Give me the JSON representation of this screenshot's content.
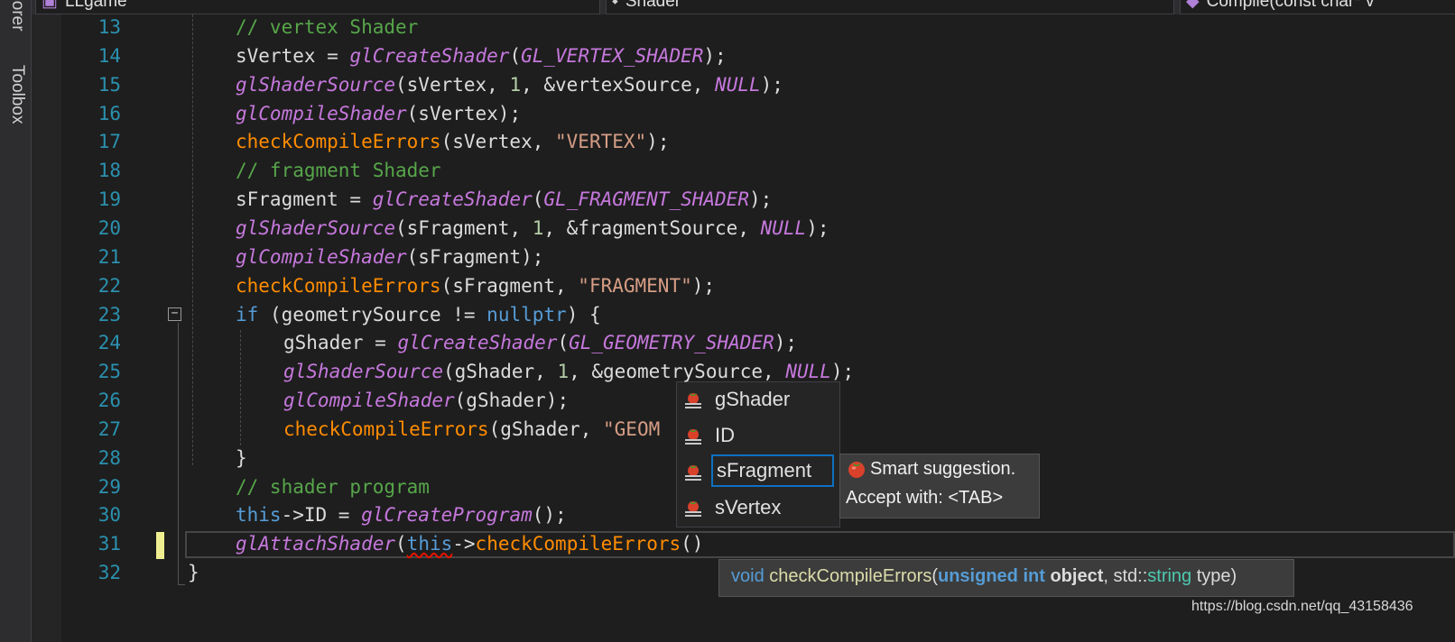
{
  "side_tabs": {
    "explorer": "plorer",
    "toolbox": "Toolbox"
  },
  "navbar": {
    "project": "LLgame",
    "class": "Shader",
    "member": "Compile(const char* v"
  },
  "lines": [
    {
      "n": "13",
      "tokens": [
        [
          "cm",
          "// vertex Shader"
        ]
      ]
    },
    {
      "n": "14",
      "tokens": [
        [
          "",
          "sVertex = "
        ],
        [
          "fn",
          "glCreateShader"
        ],
        [
          "",
          "("
        ],
        [
          "mac",
          "GL_VERTEX_SHADER"
        ],
        [
          "",
          ");"
        ]
      ]
    },
    {
      "n": "15",
      "tokens": [
        [
          "fn",
          "glShaderSource"
        ],
        [
          "",
          "(sVertex, "
        ],
        [
          "lit",
          "1"
        ],
        [
          "",
          ", &vertexSource, "
        ],
        [
          "mac",
          "NULL"
        ],
        [
          "",
          ");"
        ]
      ]
    },
    {
      "n": "16",
      "tokens": [
        [
          "fn",
          "glCompileShader"
        ],
        [
          "",
          "(sVertex);"
        ]
      ]
    },
    {
      "n": "17",
      "tokens": [
        [
          "ufn",
          "checkCompileErrors"
        ],
        [
          "",
          "(sVertex, "
        ],
        [
          "str",
          "\"VERTEX\""
        ],
        [
          "",
          ");"
        ]
      ]
    },
    {
      "n": "18",
      "tokens": [
        [
          "cm",
          "// fragment Shader"
        ]
      ]
    },
    {
      "n": "19",
      "tokens": [
        [
          "",
          "sFragment = "
        ],
        [
          "fn",
          "glCreateShader"
        ],
        [
          "",
          "("
        ],
        [
          "mac",
          "GL_FRAGMENT_SHADER"
        ],
        [
          "",
          ");"
        ]
      ]
    },
    {
      "n": "20",
      "tokens": [
        [
          "fn",
          "glShaderSource"
        ],
        [
          "",
          "(sFragment, "
        ],
        [
          "lit",
          "1"
        ],
        [
          "",
          ", &fragmentSource, "
        ],
        [
          "mac",
          "NULL"
        ],
        [
          "",
          ");"
        ]
      ]
    },
    {
      "n": "21",
      "tokens": [
        [
          "fn",
          "glCompileShader"
        ],
        [
          "",
          "(sFragment);"
        ]
      ]
    },
    {
      "n": "22",
      "tokens": [
        [
          "ufn",
          "checkCompileErrors"
        ],
        [
          "",
          "(sFragment, "
        ],
        [
          "str",
          "\"FRAGMENT\""
        ],
        [
          "",
          ");"
        ]
      ]
    },
    {
      "n": "23",
      "tokens": [
        [
          "kw",
          "if"
        ],
        [
          "",
          " (geometrySource != "
        ],
        [
          "kw",
          "nullptr"
        ],
        [
          "",
          ") {"
        ]
      ]
    },
    {
      "n": "24",
      "tokens": [
        [
          "",
          "gShader = "
        ],
        [
          "fn",
          "glCreateShader"
        ],
        [
          "",
          "("
        ],
        [
          "mac",
          "GL_GEOMETRY_SHADER"
        ],
        [
          "",
          ");"
        ]
      ]
    },
    {
      "n": "25",
      "tokens": [
        [
          "fn",
          "glShaderSource"
        ],
        [
          "",
          "(gShader, "
        ],
        [
          "lit",
          "1"
        ],
        [
          "",
          ", &geometrySource, "
        ],
        [
          "mac",
          "NULL"
        ],
        [
          "",
          ");"
        ]
      ]
    },
    {
      "n": "26",
      "tokens": [
        [
          "fn",
          "glCompileShader"
        ],
        [
          "",
          "(gShader);"
        ]
      ]
    },
    {
      "n": "27",
      "tokens": [
        [
          "ufn",
          "checkCompileErrors"
        ],
        [
          "",
          "(gShader, "
        ],
        [
          "str",
          "\"GEOM"
        ]
      ]
    },
    {
      "n": "28",
      "tokens": [
        [
          "",
          "}"
        ]
      ]
    },
    {
      "n": "29",
      "tokens": [
        [
          "cm",
          "// shader program"
        ]
      ]
    },
    {
      "n": "30",
      "tokens": [
        [
          "kw",
          "this"
        ],
        [
          "",
          "->ID = "
        ],
        [
          "fn",
          "glCreateProgram"
        ],
        [
          "",
          "();"
        ]
      ]
    },
    {
      "n": "31",
      "tokens": [
        [
          "fn",
          "glAttachShader"
        ],
        [
          "",
          "("
        ],
        [
          "kw squig",
          "this"
        ],
        [
          "",
          "->"
        ],
        [
          "ufn",
          "checkCompileErrors"
        ],
        [
          "",
          "()"
        ]
      ]
    },
    {
      "n": "32",
      "tokens": [
        [
          "",
          "}"
        ]
      ]
    }
  ],
  "completion": {
    "items": [
      "gShader",
      "ID",
      "sFragment",
      "sVertex"
    ],
    "selected_index": 2
  },
  "suggestion_tip": {
    "line1": "Smart suggestion.",
    "line2": "Accept with: <TAB>"
  },
  "param_info": {
    "ret": "void",
    "name": "checkCompileErrors",
    "open": "(",
    "p1_type": "unsigned int",
    "p1_name": "object",
    "sep": ", std::",
    "p2_type": "string",
    "p2_name": " type",
    "close": ")"
  },
  "watermark": "https://blog.csdn.net/qq_43158436",
  "colors": {
    "background": "#1e1e1e",
    "line_number": "#2b91af",
    "comment": "#57a64a",
    "gl_function": "#c678dd",
    "user_function": "#ff8c00",
    "keyword": "#569cd6",
    "string": "#d69d85",
    "selection_border": "#0e70c0"
  },
  "icons": {
    "completion_item": "field-member-icon",
    "suggestion": "tomato-suggestion-icon",
    "fold": "collapse-minus-icon"
  }
}
